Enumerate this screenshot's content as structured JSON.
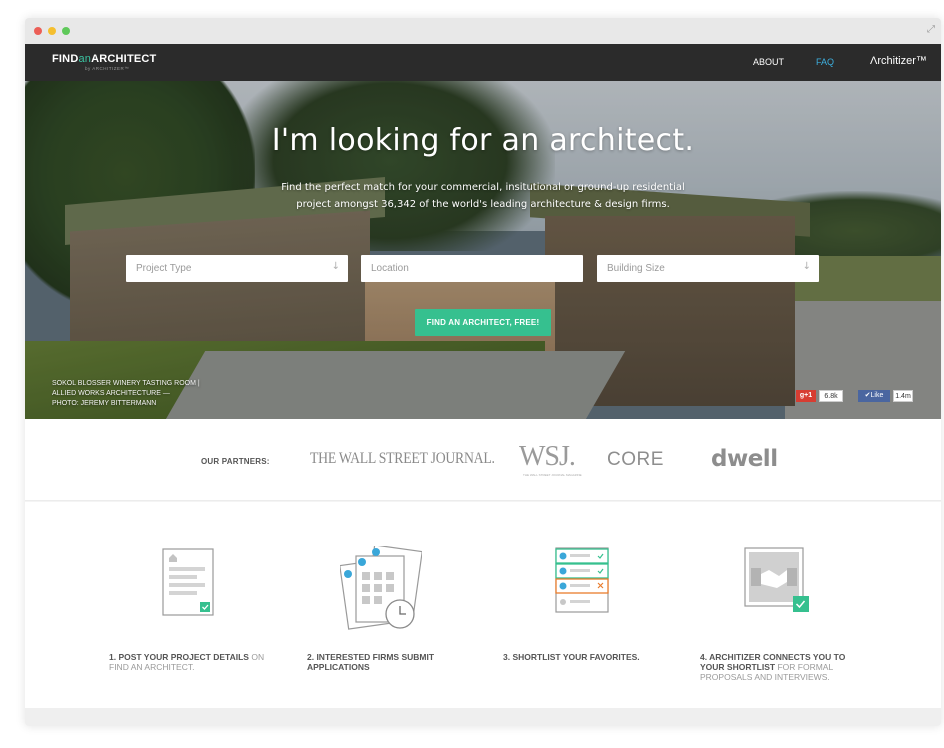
{
  "window": {
    "expand_glyph": "⤢"
  },
  "nav": {
    "logo_find": "FIND",
    "logo_an": "an",
    "logo_architect": "ARCHITECT",
    "logo_sub": "by ARCHITIZER™",
    "about": "ABOUT",
    "faq": "FAQ",
    "brand": "Λrchitizer™",
    "faq_color": "#3db0e0"
  },
  "hero": {
    "title": "I'm looking for an architect.",
    "subtitle": "Find the perfect match for your commercial, insitutional or ground-up residential project amongst 36,342 of the world's leading architecture & design firms.",
    "fields": {
      "project_type": "Project Type",
      "location": "Location",
      "building_size": "Building Size"
    },
    "dropdown_glyph": "↓",
    "cta": "FIND AN ARCHITECT, FREE!",
    "cta_color": "#36c08f",
    "caption": {
      "line1": "SOKOL BLOSSER WINERY TASTING ROOM |",
      "line2": "ALLIED WORKS ARCHITECTURE —",
      "line3": "PHOTO: JEREMY BITTERMANN"
    },
    "social": {
      "gplus": "g+1",
      "gplus_count": "6.8k",
      "fb_like": "✔Like",
      "fb_count": "1.4m"
    }
  },
  "partners": {
    "label": "OUR PARTNERS:",
    "items": [
      "THE WALL STREET JOURNAL.",
      "WSJ.",
      "CORE",
      "dwell"
    ],
    "wsj_sub": "THE WALL STREET JOURNAL MAGAZINE"
  },
  "steps": [
    {
      "bold": "1. POST YOUR PROJECT DETAILS",
      "rest": " ON FIND AN ARCHITECT."
    },
    {
      "bold": "2. INTERESTED FIRMS SUBMIT APPLICATIONS",
      "rest": ""
    },
    {
      "bold": "3. SHORTLIST YOUR FAVORITES.",
      "rest": ""
    },
    {
      "bold": "4. ARCHITIZER CONNECTS YOU TO YOUR SHORTLIST",
      "rest": " FOR FORMAL PROPOSALS AND INTERVIEWS."
    }
  ]
}
